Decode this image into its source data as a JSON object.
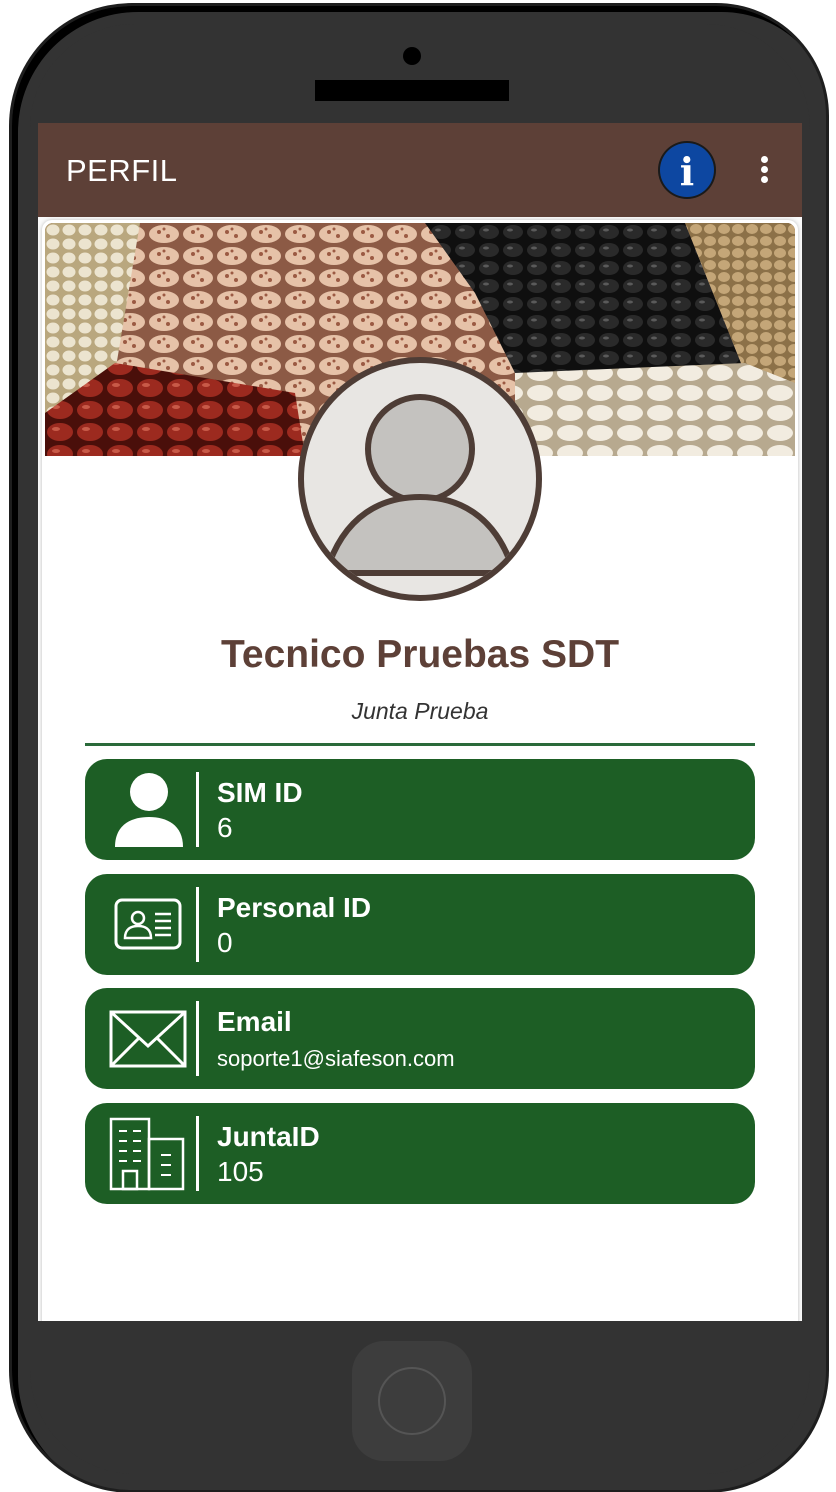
{
  "app": {
    "title": "PERFIL",
    "info_icon_glyph": "i",
    "icons": [
      "info-icon",
      "more-vert-icon"
    ],
    "accent_color": "#5d4037",
    "card_color": "#1d5e25"
  },
  "profile": {
    "name": "Tecnico Pruebas SDT",
    "organization": "Junta Prueba",
    "avatar_icon": "person-placeholder-icon",
    "banner_image": "beans-banner"
  },
  "fields": [
    {
      "icon": "person-icon",
      "label": "SIM ID",
      "value": "6"
    },
    {
      "icon": "id-card-icon",
      "label": "Personal ID",
      "value": "0"
    },
    {
      "icon": "envelope-icon",
      "label": "Email",
      "value": "soporte1@siafeson.com"
    },
    {
      "icon": "building-icon",
      "label": "JuntaID",
      "value": "105"
    }
  ]
}
